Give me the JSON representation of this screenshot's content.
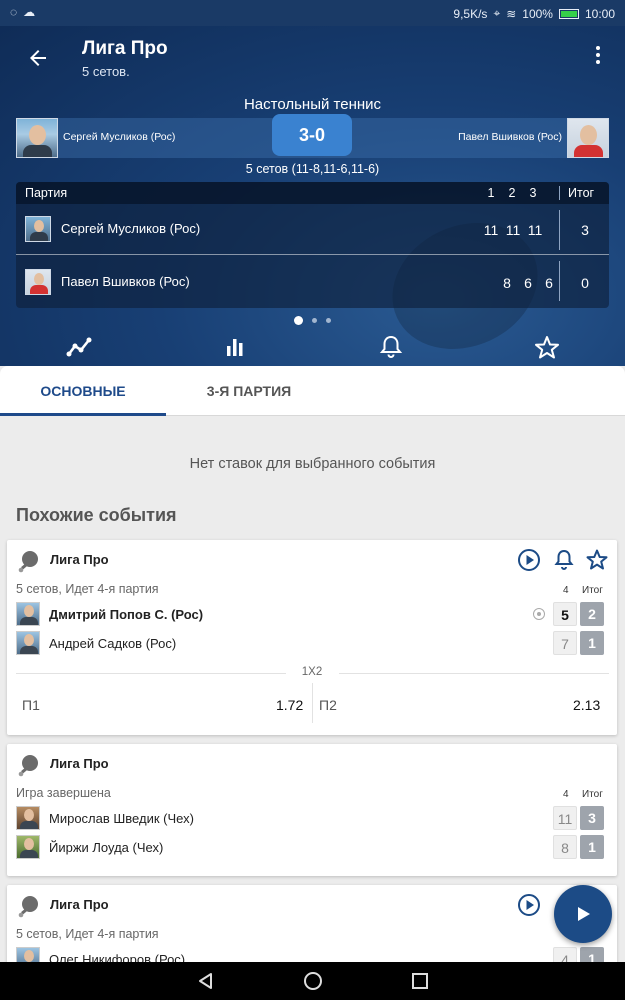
{
  "status_bar": {
    "speed": "9,5K/s",
    "battery": "100%",
    "time": "10:00"
  },
  "header": {
    "title": "Лига Про",
    "subtitle": "5 сетов.",
    "sport": "Настольный теннис",
    "player1": "Сергей Мусликов (Рос)",
    "player2": "Павел Вшивков (Рос)",
    "score": "3-0",
    "set_summary": "5 сетов (11-8,11-6,11-6)"
  },
  "score_table": {
    "label": "Партия",
    "cols": [
      "1",
      "2",
      "3"
    ],
    "total_label": "Итог",
    "rows": [
      {
        "name": "Сергей Мусликов (Рос)",
        "sets": [
          "11",
          "11",
          "11"
        ],
        "total": "3"
      },
      {
        "name": "Павел Вшивков (Рос)",
        "sets": [
          "8",
          "6",
          "6"
        ],
        "total": "0"
      }
    ]
  },
  "tabs": [
    {
      "label": "ОСНОВНЫЕ"
    },
    {
      "label": "3-Я ПАРТИЯ"
    }
  ],
  "no_bets": "Нет ставок для выбранного события",
  "similar_title": "Похожие события",
  "cards": [
    {
      "league": "Лига Про",
      "status": "5 сетов, Идет 4-я партия",
      "col": "4",
      "total_label": "Итог",
      "players": [
        {
          "name": "Дмитрий Попов С. (Рос)",
          "set": "5",
          "total": "2"
        },
        {
          "name": "Андрей Садков (Рос)",
          "set": "7",
          "total": "1"
        }
      ],
      "market": "1X2",
      "odds": [
        {
          "label": "П1",
          "value": "1.72"
        },
        {
          "label": "П2",
          "value": "2.13"
        }
      ]
    },
    {
      "league": "Лига Про",
      "status": "Игра завершена",
      "col": "4",
      "total_label": "Итог",
      "players": [
        {
          "name": "Мирослав Шведик (Чех)",
          "set": "11",
          "total": "3"
        },
        {
          "name": "Йиржи Лоуда (Чех)",
          "set": "8",
          "total": "1"
        }
      ]
    },
    {
      "league": "Лига Про",
      "status": "5 сетов, Идет 4-я партия",
      "players": [
        {
          "name": "Олег Никифоров (Рос)",
          "set": "4",
          "total": "1"
        }
      ]
    }
  ]
}
